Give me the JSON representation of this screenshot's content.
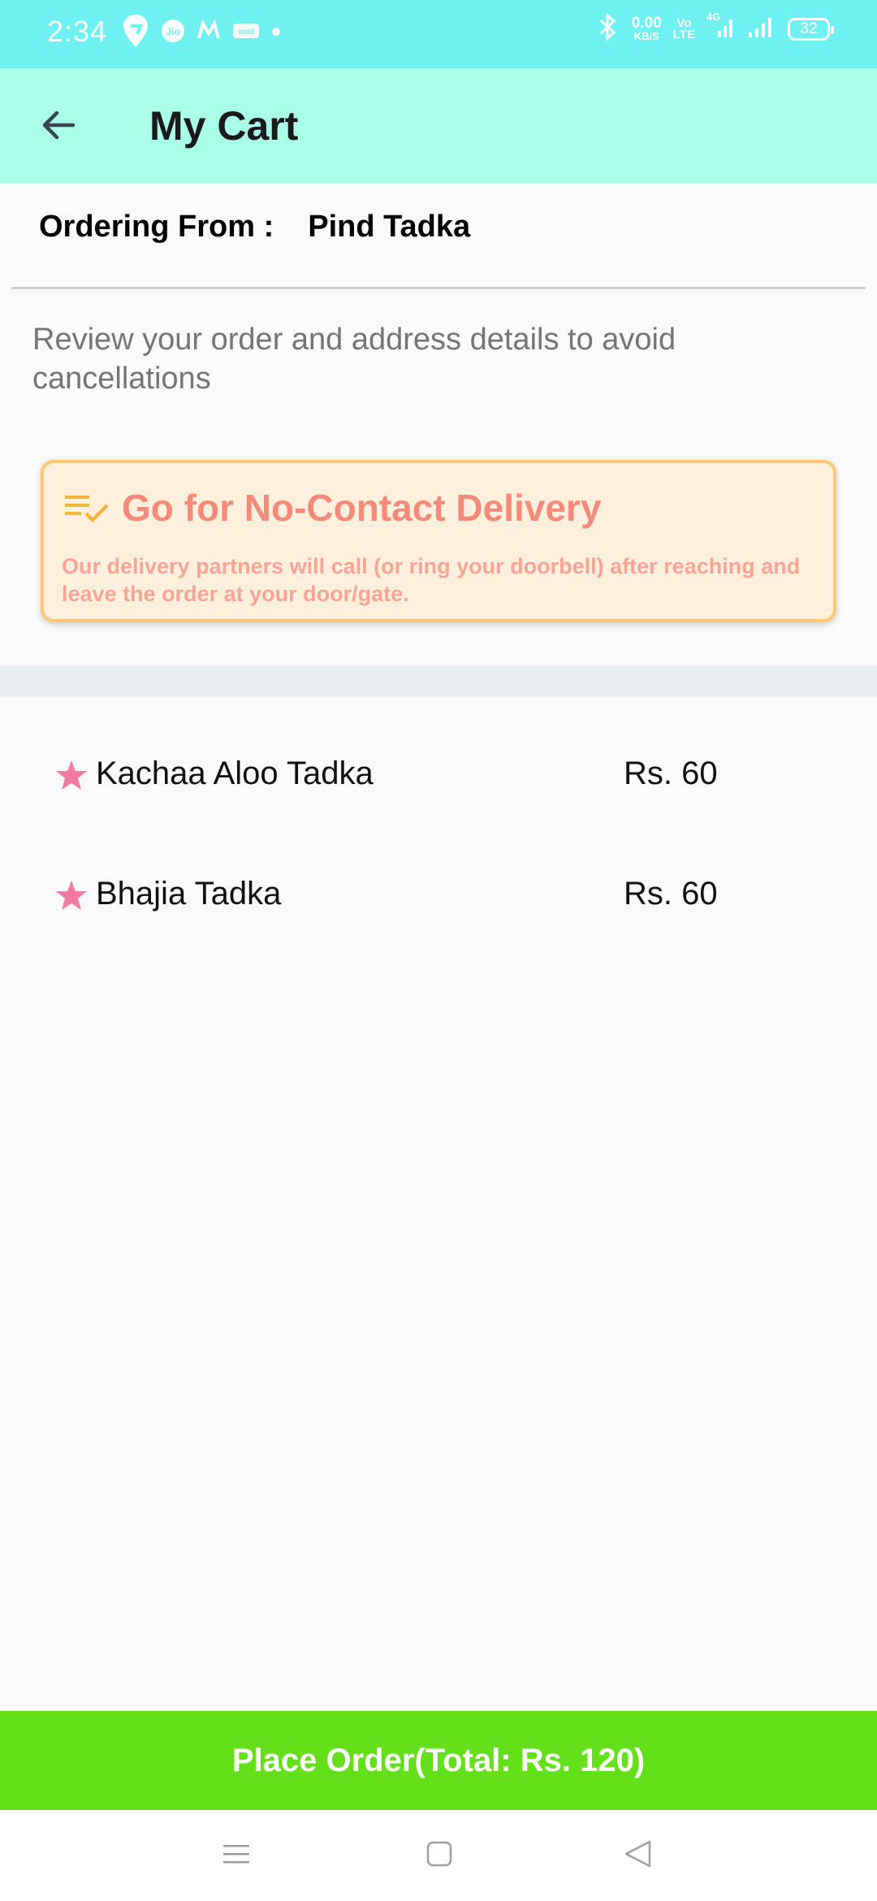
{
  "status_bar": {
    "time": "2:34",
    "speed_value": "0.00",
    "speed_unit": "KB/S",
    "volte_top": "Vo",
    "volte_bottom": "LTE",
    "network": "4G",
    "battery": "32",
    "icons": [
      "swiggy-icon",
      "jio-icon",
      "myntra-icon",
      "voot-icon",
      "dot-icon",
      "bluetooth-icon",
      "signal-icon",
      "signal-icon"
    ]
  },
  "app_bar": {
    "title": "My Cart",
    "back_icon": "arrow-left-icon"
  },
  "ordering": {
    "label": "Ordering From :",
    "restaurant": "Pind Tadka"
  },
  "review_message": "Review your order and address details to avoid cancellations",
  "no_contact": {
    "title": "Go for No-Contact Delivery",
    "description": "Our delivery partners will call (or ring your doorbell) after reaching and leave the order at your door/gate.",
    "icon": "checklist-icon",
    "title_color": "#f48a7a",
    "background": "#fff0de",
    "border": "#fcc876"
  },
  "items": [
    {
      "name": "Kachaa Aloo Tadka",
      "price": "Rs. 60",
      "icon": "star-icon"
    },
    {
      "name": "Bhajia Tadka",
      "price": "Rs. 60",
      "icon": "star-icon"
    }
  ],
  "place_order": {
    "label": "Place Order(Total: Rs. 120)",
    "color": "#63e01a"
  },
  "nav_bar": {
    "icons": [
      "menu-icon",
      "home-square-icon",
      "back-triangle-icon"
    ]
  },
  "colors": {
    "status_bar": "#6ff0f0",
    "app_bar": "#aaffe9",
    "star": "#f47aa3"
  }
}
